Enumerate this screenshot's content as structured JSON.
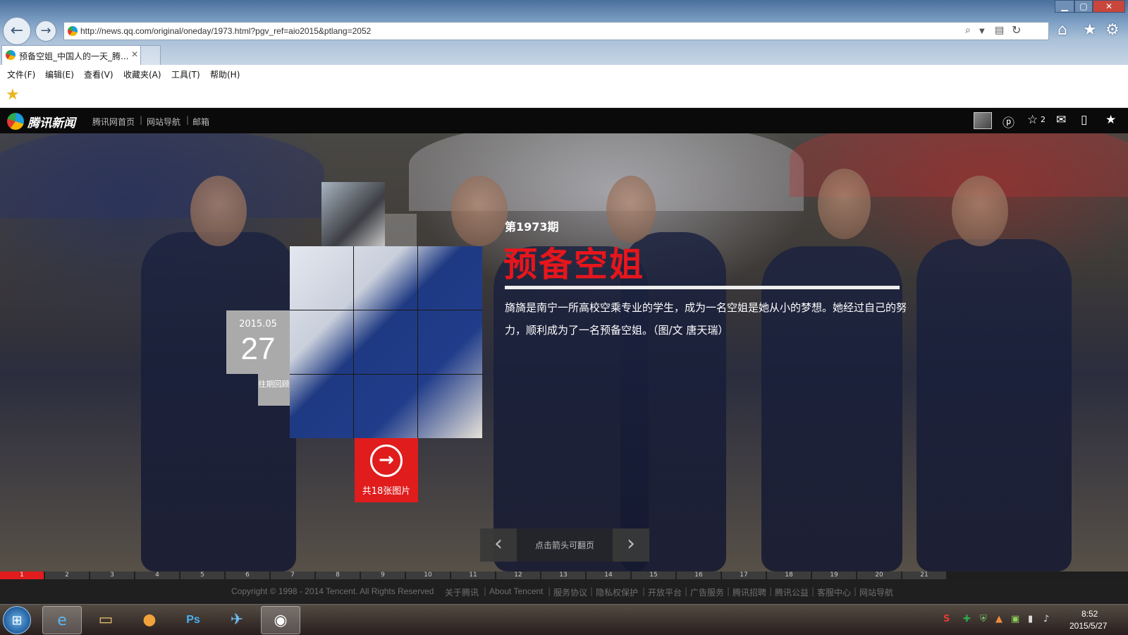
{
  "browser": {
    "window_controls": {
      "minimize": "▁",
      "maximize": "▢",
      "close": "✕"
    },
    "back_icon": "arrow-left-icon",
    "forward_icon": "arrow-right-icon",
    "url": "http://news.qq.com/original/oneday/1973.html?pgv_ref=aio2015&ptlang=2052",
    "tab_title": "预备空姐_中国人的一天_腾...",
    "menu": [
      "文件(F)",
      "编辑(E)",
      "查看(V)",
      "收藏夹(A)",
      "工具(T)",
      "帮助(H)"
    ]
  },
  "site": {
    "name": "腾讯新闻",
    "links": [
      "腾讯网首页",
      "网站导航",
      "邮箱"
    ],
    "favorites_count": "2"
  },
  "article": {
    "issue": "第1973期",
    "headline": "预备空姐",
    "summary": "旖旖是南宁一所高校空乘专业的学生，成为一名空姐是她从小的梦想。她经过自己的努力，顺利成为了一名预备空姐。（图/文 唐天瑞）",
    "date_year_month": "2015.05",
    "date_day": "27",
    "archive_label": "往期回顾",
    "photo_count": "共18张图片"
  },
  "pager": {
    "prev": "‹",
    "next": "›",
    "hint": "点击箭头可翻页"
  },
  "timeline": {
    "items": [
      "1",
      "2",
      "3",
      "4",
      "5",
      "6",
      "7",
      "8",
      "9",
      "10",
      "11",
      "12",
      "13",
      "14",
      "15",
      "16",
      "17",
      "18",
      "19",
      "20",
      "21"
    ],
    "active": "1"
  },
  "footer": {
    "copyright": "Copyright © 1998 - 2014 Tencent. All Rights Reserved",
    "links": [
      "关于腾讯",
      "About Tencent",
      "服务协议",
      "隐私权保护",
      "开放平台",
      "广告服务",
      "腾讯招聘",
      "腾讯公益",
      "客服中心",
      "网站导航"
    ]
  },
  "taskbar": {
    "time": "8:52",
    "date": "2015/5/27"
  },
  "colors": {
    "accent_red": "#e01c1c",
    "header_black": "#0a0a0a"
  }
}
